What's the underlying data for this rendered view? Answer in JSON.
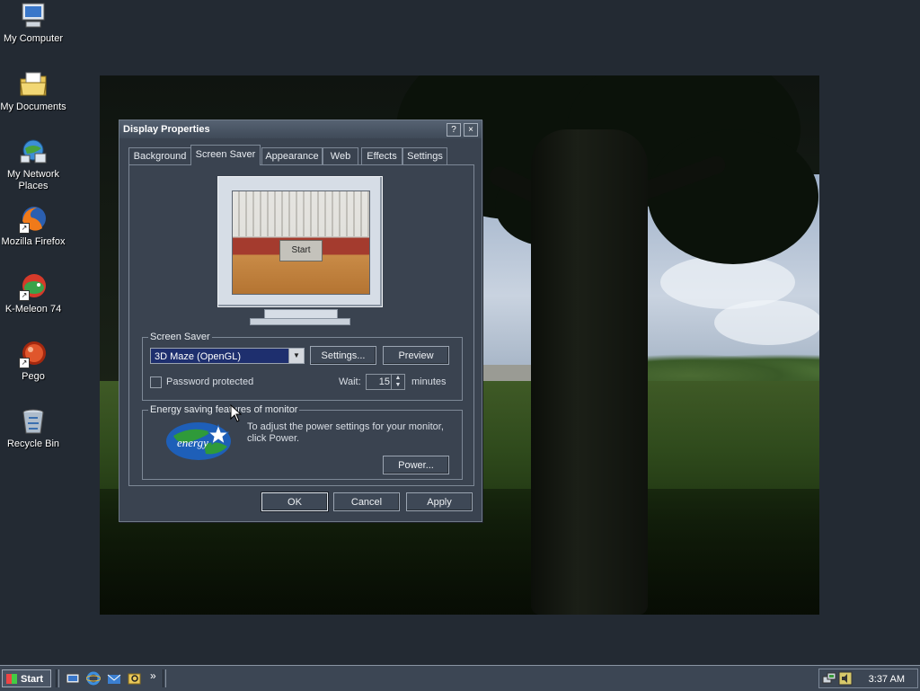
{
  "desktop": {
    "icons": [
      {
        "label": "My Computer",
        "icon": "my-computer-icon"
      },
      {
        "label": "My Documents",
        "icon": "my-documents-icon"
      },
      {
        "label": "My Network Places",
        "icon": "network-places-icon"
      },
      {
        "label": "Mozilla Firefox",
        "icon": "firefox-icon"
      },
      {
        "label": "K-Meleon 74",
        "icon": "k-meleon-icon"
      },
      {
        "label": "Pego",
        "icon": "pego-icon"
      },
      {
        "label": "Recycle Bin",
        "icon": "recycle-bin-icon"
      }
    ]
  },
  "dialog": {
    "title": "Display Properties",
    "help_glyph": "?",
    "close_glyph": "×",
    "tabs": [
      "Background",
      "Screen Saver",
      "Appearance",
      "Web",
      "Effects",
      "Settings"
    ],
    "active_tab": "Screen Saver",
    "preview_text": "Start",
    "screensaver": {
      "legend": "Screen Saver",
      "selected": "3D Maze (OpenGL)",
      "settings_button": "Settings...",
      "preview_button": "Preview",
      "password_label": "Password protected",
      "password_checked": false,
      "wait_label": "Wait:",
      "wait_value": "15",
      "wait_unit": "minutes"
    },
    "energy": {
      "legend": "Energy saving features of monitor",
      "text": "To adjust the power settings for your monitor, click Power.",
      "power_button": "Power...",
      "logo_text": "energy"
    },
    "buttons": {
      "ok": "OK",
      "cancel": "Cancel",
      "apply": "Apply"
    }
  },
  "taskbar": {
    "start_label": "Start",
    "chevron": "»",
    "clock": "3:37 AM"
  },
  "colors": {
    "desktop_bg": "#232a33",
    "dialog_bg": "#3a4350",
    "selection": "#1e2f6e"
  }
}
